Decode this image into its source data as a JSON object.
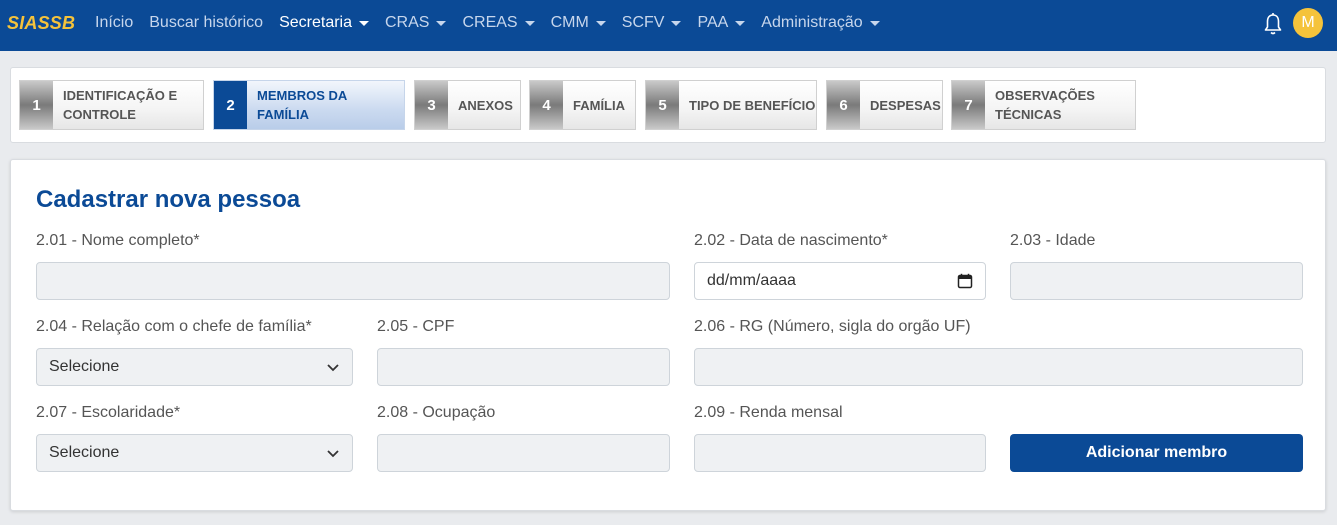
{
  "navbar": {
    "brand": "SIASSB",
    "items": [
      {
        "label": "Início",
        "dropdown": false,
        "active": false
      },
      {
        "label": "Buscar histórico",
        "dropdown": false,
        "active": false
      },
      {
        "label": "Secretaria",
        "dropdown": true,
        "active": true
      },
      {
        "label": "CRAS",
        "dropdown": true,
        "active": false
      },
      {
        "label": "CREAS",
        "dropdown": true,
        "active": false
      },
      {
        "label": "CMM",
        "dropdown": true,
        "active": false
      },
      {
        "label": "SCFV",
        "dropdown": true,
        "active": false
      },
      {
        "label": "PAA",
        "dropdown": true,
        "active": false
      },
      {
        "label": "Administração",
        "dropdown": true,
        "active": false
      }
    ],
    "bell_icon": "bell-icon",
    "avatar_letter": "M"
  },
  "steps": [
    {
      "number": "1",
      "line1": "IDENTIFICAÇÃO E",
      "line2": "CONTROLE",
      "current": false
    },
    {
      "number": "2",
      "line1": "MEMBROS DA",
      "line2": "FAMÍLIA",
      "current": true
    },
    {
      "number": "3",
      "line1": "ANEXOS",
      "line2": "",
      "current": false
    },
    {
      "number": "4",
      "line1": "FAMÍLIA",
      "line2": "",
      "current": false
    },
    {
      "number": "5",
      "line1": "TIPO DE BENEFÍCIO",
      "line2": "",
      "current": false
    },
    {
      "number": "6",
      "line1": "DESPESAS",
      "line2": "",
      "current": false
    },
    {
      "number": "7",
      "line1": "OBSERVAÇÕES",
      "line2": "TÉCNICAS",
      "current": false
    }
  ],
  "form": {
    "title": "Cadastrar nova pessoa",
    "fields": {
      "nome": {
        "label": "2.01 - Nome completo*",
        "value": ""
      },
      "nascimento": {
        "label": "2.02 - Data de nascimento*",
        "placeholder": "dd/mm/aaaa"
      },
      "idade": {
        "label": "2.03 - Idade",
        "value": ""
      },
      "relacao": {
        "label": "2.04 - Relação com o chefe de família*",
        "selected": "Selecione"
      },
      "cpf": {
        "label": "2.05 - CPF",
        "value": ""
      },
      "rg": {
        "label": "2.06 - RG (Número, sigla do orgão UF)",
        "value": ""
      },
      "escolaridade": {
        "label": "2.07 - Escolaridade*",
        "selected": "Selecione"
      },
      "ocupacao": {
        "label": "2.08 - Ocupação",
        "value": ""
      },
      "renda": {
        "label": "2.09 - Renda mensal",
        "value": ""
      }
    },
    "submit_label": "Adicionar membro"
  },
  "colors": {
    "primary": "#0b4a96",
    "brand_yellow": "#f5c33b",
    "field_bg": "#eff1f3"
  }
}
